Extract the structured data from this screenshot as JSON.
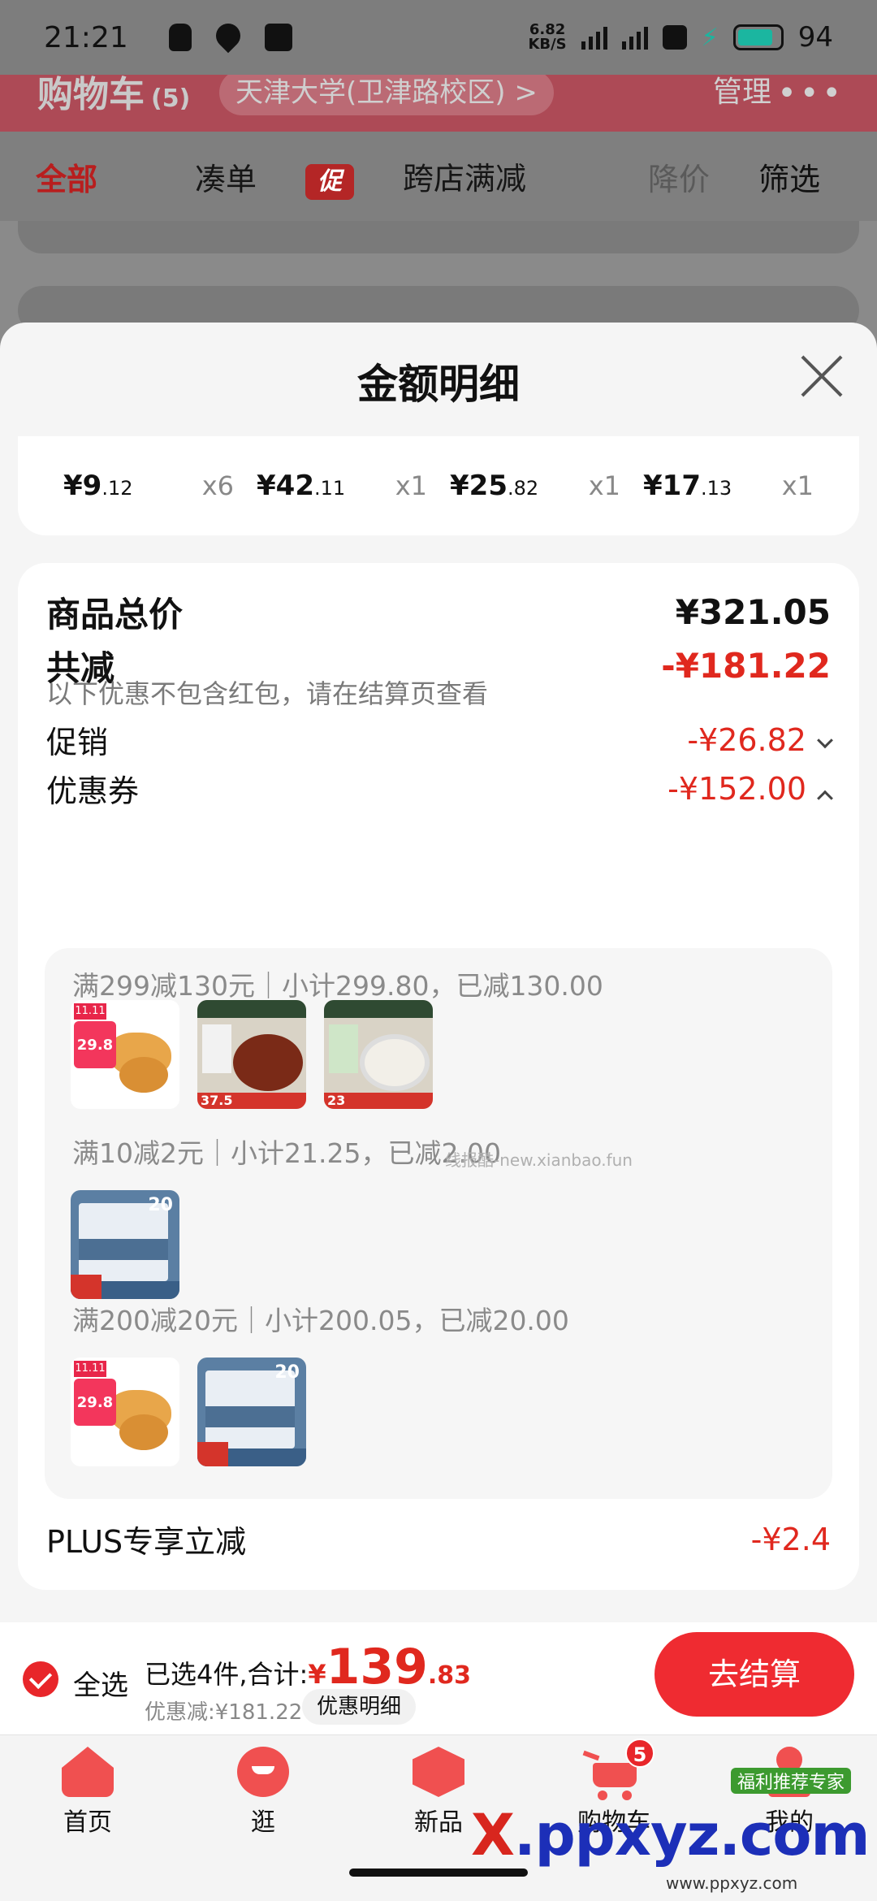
{
  "status_bar": {
    "time": "21:21",
    "net_speed_value": "6.82",
    "net_speed_unit": "KB/S",
    "battery": "94"
  },
  "background": {
    "cart_title": "购物车",
    "cart_count": "(5)",
    "location": "天津大学(卫津路校区) >",
    "manage": "管理",
    "tabs": {
      "all": "全部",
      "combine": "凑单",
      "promo_tag": "促",
      "cross_store": "跨店满减",
      "price_drop": "降价",
      "filter": "筛选"
    }
  },
  "sheet": {
    "title": "金额明细",
    "items": [
      {
        "yen": "¥",
        "int": "9",
        "dec": ".12",
        "qty": "x6"
      },
      {
        "yen": "¥",
        "int": "42",
        "dec": ".11",
        "qty": "x1"
      },
      {
        "yen": "¥",
        "int": "25",
        "dec": ".82",
        "qty": "x1"
      },
      {
        "yen": "¥",
        "int": "17",
        "dec": ".13",
        "qty": "x1"
      }
    ],
    "total_label": "商品总价",
    "total_value": "¥321.05",
    "reduce_label": "共减",
    "reduce_value": "-¥181.22",
    "reduce_note": "以下优惠不包含红包，请在结算页查看",
    "promo_label": "促销",
    "promo_value": "-¥26.82",
    "coupon_label": "优惠券",
    "coupon_value": "-¥152.00",
    "coupon_groups": [
      {
        "title": "满299减130元｜小计299.80，已减130.00"
      },
      {
        "title": "满10减2元｜小计21.25，已减2.00"
      },
      {
        "title": "满200减20元｜小计200.05，已减20.00"
      }
    ],
    "thumb_text": {
      "nugget_price": "29.8",
      "nugget_ribbon": "11.11",
      "noodle1_price": "37.5",
      "noodle2_price": "23",
      "towel_count": "20"
    },
    "plus_label": "PLUS专享立减",
    "plus_value": "-¥2.4",
    "watermark": "线报酷-new.xianbao.fun"
  },
  "action_bar": {
    "select_all": "全选",
    "selected_text": "已选4件,合计:",
    "total_yen": "¥",
    "total_int": "139",
    "total_dec": ".83",
    "discount_text": "优惠减:¥181.22",
    "detail_button": "优惠明细",
    "checkout": "去结算"
  },
  "bottom_nav": {
    "items": [
      {
        "label": "首页",
        "icon": "home-icon"
      },
      {
        "label": "逛",
        "icon": "browse-icon"
      },
      {
        "label": "新品",
        "icon": "new-icon"
      },
      {
        "label": "购物车",
        "icon": "cart-icon",
        "badge": "5"
      },
      {
        "label": "我的",
        "icon": "profile-icon"
      }
    ]
  },
  "overlay_watermarks": {
    "logo_x": "X",
    "logo_rest": ".ppxyz.com",
    "sub": "www.ppxyz.com",
    "green": "福利推荐专家"
  },
  "colors": {
    "accent_red": "#e0281e",
    "checkout_red": "#ef2b31",
    "icon_red": "#f05050"
  }
}
